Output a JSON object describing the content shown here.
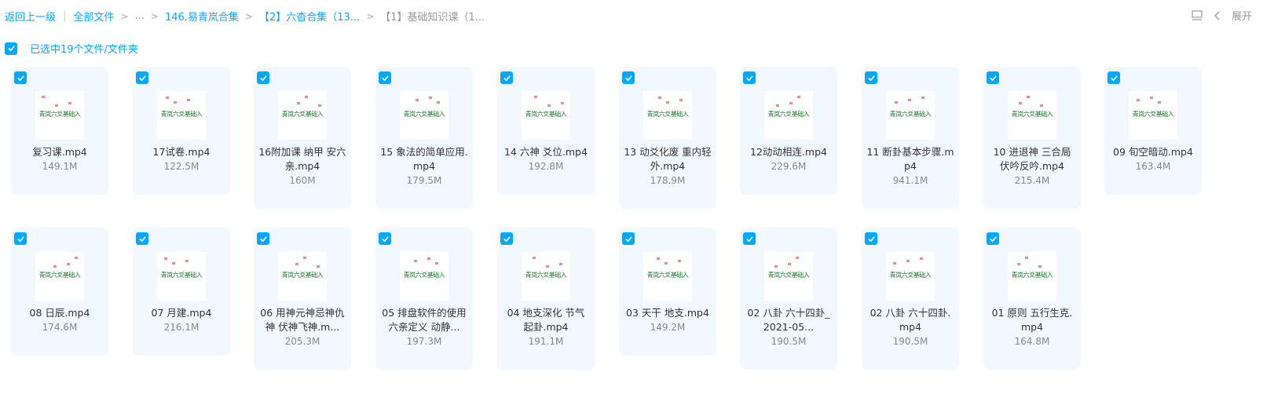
{
  "breadcrumb": {
    "back": "返回上一级",
    "all_files": "全部文件",
    "ellipsis": "...",
    "folder1": "146.易青岚合集",
    "folder2": "【2】六杳合集（13...",
    "current": "【1】基础知识课（1..."
  },
  "toolbar": {
    "expand_label": "展开"
  },
  "selection": {
    "label": "已选中19个文件/文件夹"
  },
  "thumbnail_text": "青岚六爻基础入",
  "files": [
    {
      "name": "复习课.mp4",
      "size": "149.1M"
    },
    {
      "name": "17试卷.mp4",
      "size": "122.5M"
    },
    {
      "name": "16附加课 纳甲 安六亲.mp4",
      "size": "160M"
    },
    {
      "name": "15 象法的简单应用.mp4",
      "size": "179.5M"
    },
    {
      "name": "14 六神 爻位.mp4",
      "size": "192.8M"
    },
    {
      "name": "13 动爻化废 重内轻外.mp4",
      "size": "178.9M"
    },
    {
      "name": "12动动相连.mp4",
      "size": "229.6M"
    },
    {
      "name": "11 断卦基本步骤.mp4",
      "size": "941.1M"
    },
    {
      "name": "10 进退神 三合局 伏吟反吟.mp4",
      "size": "215.4M"
    },
    {
      "name": "09 旬空暗动.mp4",
      "size": "163.4M"
    },
    {
      "name": "08 日辰.mp4",
      "size": "174.6M"
    },
    {
      "name": "07 月建.mp4",
      "size": "216.1M"
    },
    {
      "name": "06 用神元神忌神仇神 伏神飞神.m...",
      "size": "205.3M"
    },
    {
      "name": "05 排盘软件的使用 六亲定义 动静...",
      "size": "197.3M"
    },
    {
      "name": "04 地支深化 节气 起卦.mp4",
      "size": "191.1M"
    },
    {
      "name": "03 天干 地支.mp4",
      "size": "149.2M"
    },
    {
      "name": "02 八卦 六十四卦_2021-05...",
      "size": "190.5M"
    },
    {
      "name": "02 八卦 六十四卦.mp4",
      "size": "190.5M"
    },
    {
      "name": "01 原则 五行生克.mp4",
      "size": "164.8M"
    }
  ]
}
